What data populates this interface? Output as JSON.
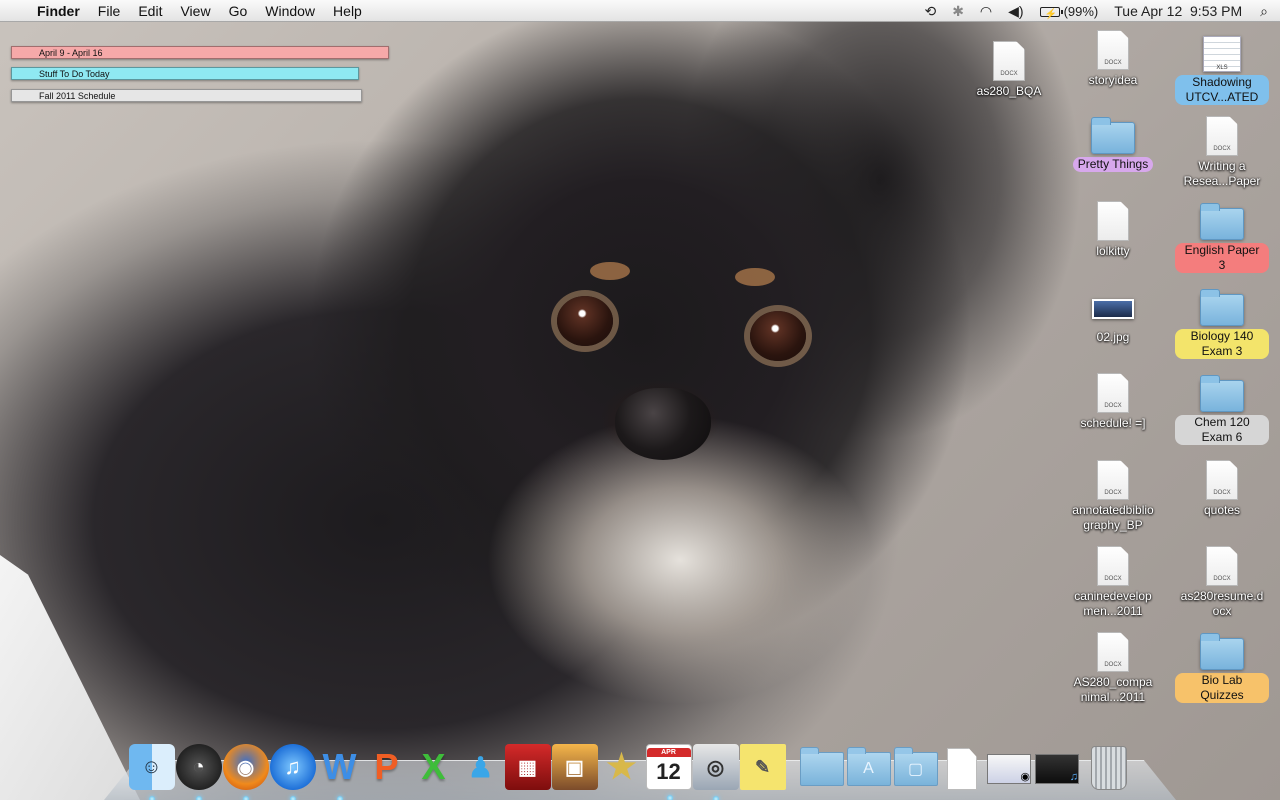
{
  "menubar": {
    "app_name": "Finder",
    "menus": [
      "File",
      "Edit",
      "View",
      "Go",
      "Window",
      "Help"
    ],
    "battery_percent": "(99%)",
    "datetime": "Tue Apr 12  9:53 PM"
  },
  "stickies": [
    "April 9 - April 16",
    "Stuff To Do Today",
    "Fall 2011 Schedule"
  ],
  "desktop_icons": {
    "col1": [
      {
        "label": "as280_BQA",
        "kind": "docx",
        "badge": "DOCX"
      }
    ],
    "col2": [
      {
        "label": "storyidea",
        "kind": "docx",
        "badge": "DOCX"
      },
      {
        "label": "Pretty Things",
        "kind": "folder",
        "tag": "purple"
      },
      {
        "label": "lolkitty",
        "kind": "doc"
      },
      {
        "label": "02.jpg",
        "kind": "jpg"
      },
      {
        "label": "schedule! =]",
        "kind": "docx",
        "badge": "DOCX"
      },
      {
        "label": "annotatedbibliography_BP",
        "kind": "docx",
        "badge": "DOCX"
      },
      {
        "label": "caninedevelopmen...2011",
        "kind": "docx",
        "badge": "DOCX"
      },
      {
        "label": "AS280_companimal...2011",
        "kind": "docx",
        "badge": "DOCX"
      }
    ],
    "col3": [
      {
        "label": "Shadowing UTCV...ATED",
        "kind": "xls",
        "badge": "XLS",
        "tag": "blue"
      },
      {
        "label": "Writing a Resea...Paper",
        "kind": "docx",
        "badge": "DOCX"
      },
      {
        "label": "English Paper 3",
        "kind": "folder",
        "tag": "red"
      },
      {
        "label": "Biology 140 Exam 3",
        "kind": "folder",
        "tag": "yellow"
      },
      {
        "label": "Chem 120 Exam 6",
        "kind": "folder",
        "tag": "gray"
      },
      {
        "label": "quotes",
        "kind": "docx",
        "badge": "DOCX"
      },
      {
        "label": "as280resume.docx",
        "kind": "docx",
        "badge": "DOCX"
      },
      {
        "label": "Bio Lab Quizzes",
        "kind": "folder",
        "tag": "orange"
      }
    ]
  },
  "tag_colors": {
    "purple": "#d7a8ec",
    "blue": "#7fc0ec",
    "red": "#f47d7d",
    "yellow": "#f3e46b",
    "gray": "#d6d6d6",
    "orange": "#f7c26a"
  },
  "dock": {
    "ical_month": "APR",
    "ical_day": "12",
    "apps": [
      "finder",
      "dashboard",
      "firefox",
      "itunes",
      "word",
      "powerpoint",
      "excel",
      "messenger",
      "photo-booth",
      "iphoto",
      "imovie",
      "ical",
      "preview",
      "stickies"
    ],
    "running": [
      "finder",
      "dashboard",
      "firefox",
      "itunes",
      "word",
      "ical",
      "preview"
    ],
    "right_items": [
      "documents-folder",
      "applications-folder",
      "downloads-folder",
      "document",
      "minimized-window-1",
      "minimized-window-2",
      "trash"
    ]
  }
}
